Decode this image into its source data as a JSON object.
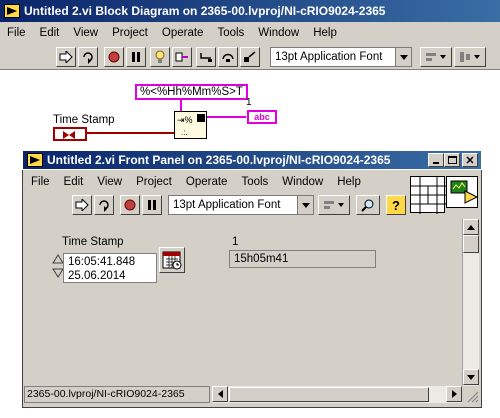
{
  "block_diagram": {
    "title": "Untitled 2.vi Block Diagram on 2365-00.lvproj/NI-cRIO9024-2365",
    "menu": [
      "File",
      "Edit",
      "View",
      "Project",
      "Operate",
      "Tools",
      "Window",
      "Help"
    ],
    "font_selector": "13pt Application Font",
    "format_string": "%<%Hh%Mm%S>T",
    "terminal_index": "1",
    "timestamp_label": "Time Stamp",
    "string_terminal": "abc"
  },
  "front_panel": {
    "title": "Untitled 2.vi Front Panel on 2365-00.lvproj/NI-cRIO9024-2365",
    "menu": [
      "File",
      "Edit",
      "View",
      "Project",
      "Operate",
      "Tools",
      "Window",
      "Help"
    ],
    "font_selector": "13pt Application Font",
    "timestamp_label": "Time Stamp",
    "time_value": "16:05:41.848",
    "date_value": "25.06.2014",
    "indicator_label": "1",
    "indicator_value": "15h05m41",
    "status_path": "2365-00.lvproj/NI-cRIO9024-2365"
  },
  "colors": {
    "title_active": "#0a246a",
    "dialog_bg": "#d4d0c8",
    "string_wire": "#e000e0",
    "timestamp_terminal": "#a00000"
  }
}
